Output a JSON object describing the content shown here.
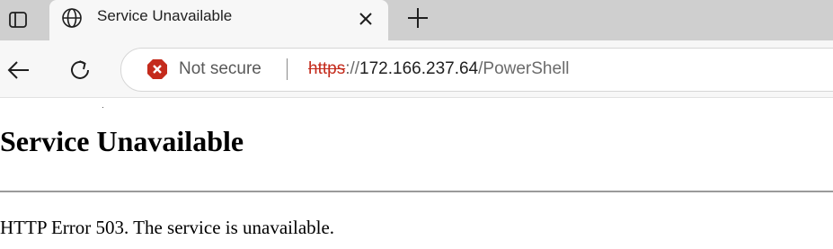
{
  "tabstrip": {
    "actions_icon": "tab-actions-icon",
    "active_tab": {
      "favicon": "globe-icon",
      "title": "Service Unavailable",
      "close_icon": "close-icon"
    },
    "new_tab_icon": "plus-icon"
  },
  "toolbar": {
    "back_icon": "arrow-left-icon",
    "refresh_icon": "refresh-icon",
    "address": {
      "security_icon": "error-icon",
      "security_label": "Not secure",
      "url_scheme": "https",
      "url_slashes": "://",
      "url_host": "172.166.237.64",
      "url_path": "/PowerShell"
    }
  },
  "page": {
    "heading": "Service Unavailable",
    "message": "HTTP Error 503. The service is unavailable."
  },
  "colors": {
    "tabstrip_bg": "#cfcfcf",
    "active_tab_bg": "#f7f7f7",
    "security_error": "#c42b1c",
    "page_bg": "#ffffff"
  }
}
